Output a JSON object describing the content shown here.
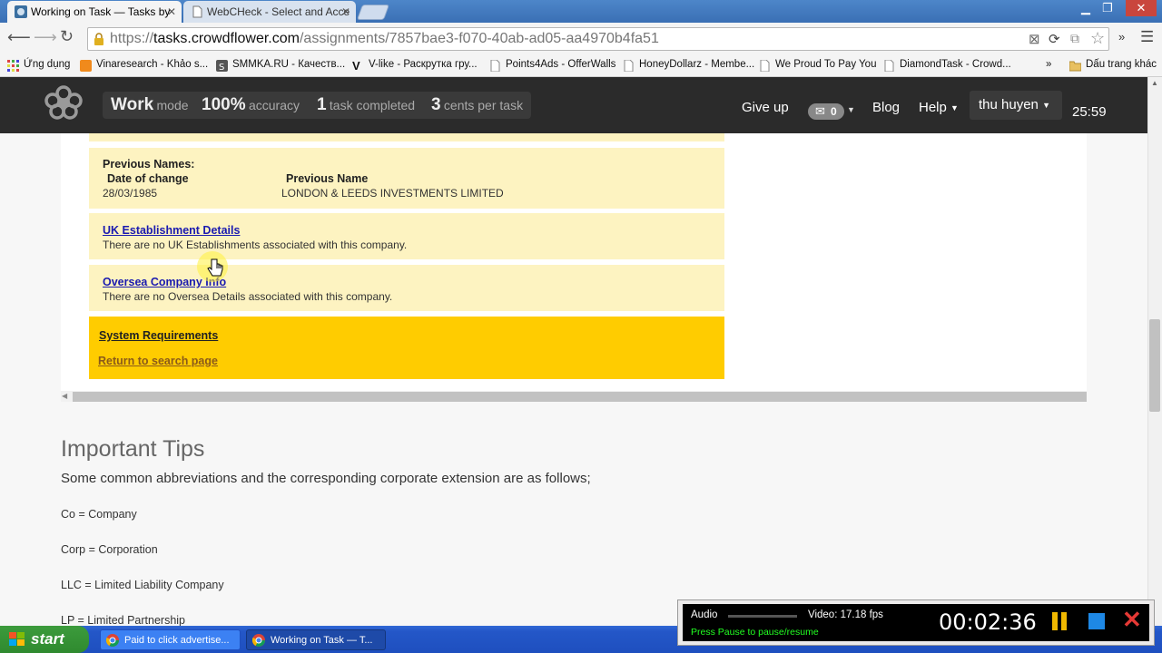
{
  "browser": {
    "tabs": [
      {
        "label": "Working on Task — Tasks by",
        "active": true
      },
      {
        "label": "WebCHeck - Select and Acce",
        "active": false
      }
    ],
    "url": {
      "prefix": "https://",
      "host": "tasks.crowdflower.com",
      "path": "/assignments/7857bae3-f070-40ab-ad05-aa4970b4fa51"
    },
    "bookmarks": [
      {
        "label": "Ứng dụng",
        "icon": "apps-grid-icon"
      },
      {
        "label": "Vinaresearch - Khảo s...",
        "icon": "vinaresearch-icon"
      },
      {
        "label": "SMMKA.RU - Качеств...",
        "icon": "smmka-icon"
      },
      {
        "label": "V-like - Раскрутка гру...",
        "icon": "vlike-icon"
      },
      {
        "label": "Points4Ads - OfferWalls",
        "icon": "page-icon"
      },
      {
        "label": "HoneyDollarz - Membe...",
        "icon": "page-icon"
      },
      {
        "label": "We Proud To Pay You",
        "icon": "page-icon"
      },
      {
        "label": "DiamondTask - Crowd...",
        "icon": "page-icon"
      }
    ],
    "bookmarks_overflow": "»",
    "other_bookmarks": "Dấu trang khác"
  },
  "header": {
    "mode_value": "Work",
    "mode_label": "mode",
    "accuracy_value": "100%",
    "accuracy_label": "accuracy",
    "tasks_value": "1",
    "tasks_label": "task completed",
    "cents_value": "3",
    "cents_label": "cents per task",
    "give_up": "Give up",
    "mail_count": "0",
    "blog": "Blog",
    "help": "Help",
    "user": "thu huyen",
    "timer": "25:59"
  },
  "frame": {
    "prev_names_title": "Previous Names:",
    "col_date": "Date of change",
    "col_name": "Previous Name",
    "row_date": "28/03/1985",
    "row_name": "LONDON & LEEDS INVESTMENTS LIMITED",
    "uk_link": "UK Establishment Details",
    "uk_text": "There are no UK Establishments associated with this company.",
    "oversea_link": "Oversea Company Info",
    "oversea_text": "There are no Oversea Details associated with this company.",
    "sys_req": "System Requirements",
    "return_link": "Return to search page"
  },
  "tips": {
    "title": "Important Tips",
    "intro": "Some common abbreviations and the corresponding corporate extension are as follows;",
    "items": [
      "Co = Company",
      "Corp = Corporation",
      "LLC = Limited Liability Company",
      "LP = Limited Partnership"
    ]
  },
  "taskbar": {
    "start": "start",
    "tasks": [
      {
        "label": "Paid to click advertise..."
      },
      {
        "label": "Working on Task — T..."
      }
    ]
  },
  "recorder": {
    "audio": "Audio",
    "video": "Video: 17.18 fps",
    "hint": "Press Pause to pause/resume",
    "time": "00:02:36"
  },
  "colors": {
    "header_bg": "#2b2b2b",
    "yellow_box": "#fdf3c1",
    "gold_box": "#ffcc00",
    "link": "#1a1ab0"
  }
}
